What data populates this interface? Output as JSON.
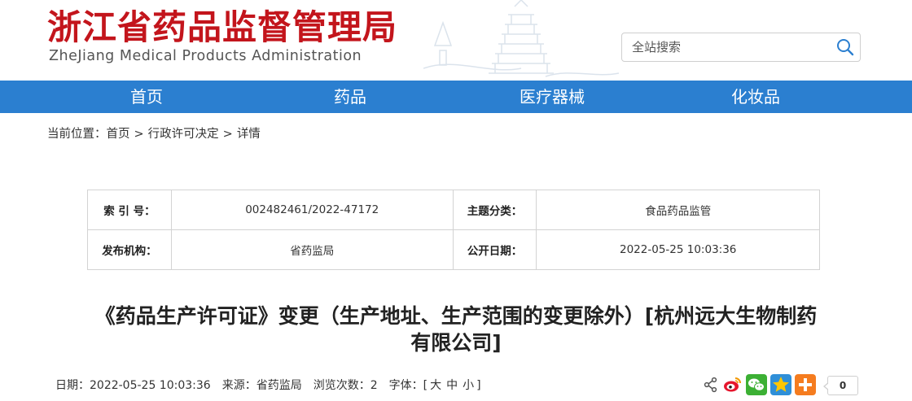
{
  "header": {
    "title_cn": "浙江省药品监督管理局",
    "title_en": "ZheJiang Medical Products Administration"
  },
  "search": {
    "placeholder": "全站搜索"
  },
  "nav": {
    "items": [
      "首页",
      "药品",
      "医疗器械",
      "化妆品"
    ]
  },
  "breadcrumb": {
    "prefix": "当前位置：",
    "items": [
      "首页",
      "行政许可决定",
      "详情"
    ],
    "separator": ">"
  },
  "info": {
    "index_label": "索 引 号：",
    "index_value": "002482461/2022-47172",
    "topic_label": "主题分类：",
    "topic_value": "食品药品监管",
    "publisher_label": "发布机构：",
    "publisher_value": "省药监局",
    "date_label": "公开日期：",
    "date_value": "2022-05-25 10:03:36"
  },
  "article": {
    "title_line1": "《药品生产许可证》变更（生产地址、生产范围的变更除外）[杭州远大生物制药",
    "title_line2": "有限公司]"
  },
  "meta": {
    "date": "日期：2022-05-25 10:03:36",
    "source": "来源：省药监局",
    "views": "浏览次数：2",
    "font_label": "字体：[",
    "font_large": "大",
    "font_medium": "中",
    "font_small": "小",
    "font_end": "]"
  },
  "share": {
    "count": "0"
  },
  "colors": {
    "brand_red": "#c3151c",
    "nav_blue": "#2b7fd0"
  }
}
